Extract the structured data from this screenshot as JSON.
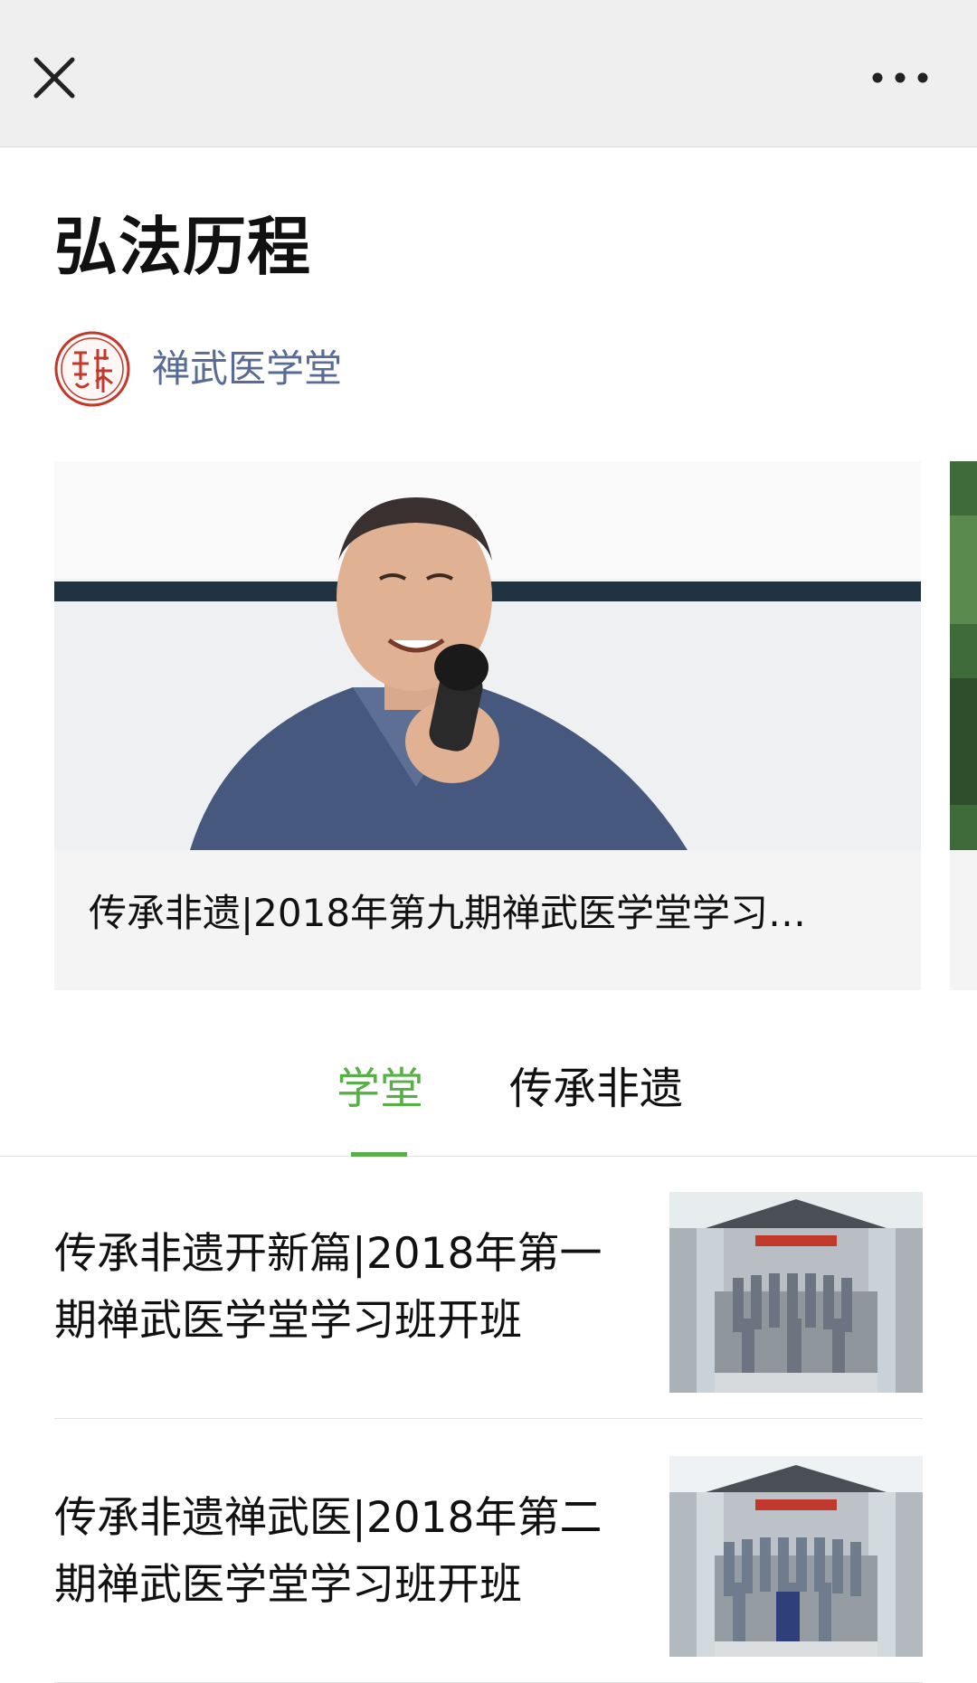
{
  "nav": {
    "close_icon": "close-icon",
    "more_icon": "more-horizontal-icon",
    "bar_color": "#efefef"
  },
  "page": {
    "title": "弘法历程"
  },
  "account": {
    "name": "禅武医学堂",
    "avatar_icon": "red-seal-logo",
    "name_color": "#576b95",
    "seal_color": "#c0392b"
  },
  "carousel": {
    "items": [
      {
        "caption": "传承非遗|2018年第九期禅武医学堂学习…",
        "image": "monk-speaking-with-microphone-photo"
      }
    ]
  },
  "tabs": {
    "active_color": "#57b046",
    "items": [
      {
        "label": "学堂",
        "active": true
      },
      {
        "label": "传承非遗",
        "active": false
      }
    ]
  },
  "articles": [
    {
      "title": "传承非遗开新篇|2018年第一期禅武医学堂学习班开班",
      "thumb": "group-photo-temple-stairs"
    },
    {
      "title": "传承非遗禅武医|2018年第二期禅武医学堂学习班开班",
      "thumb": "group-photo-temple-stairs"
    }
  ]
}
